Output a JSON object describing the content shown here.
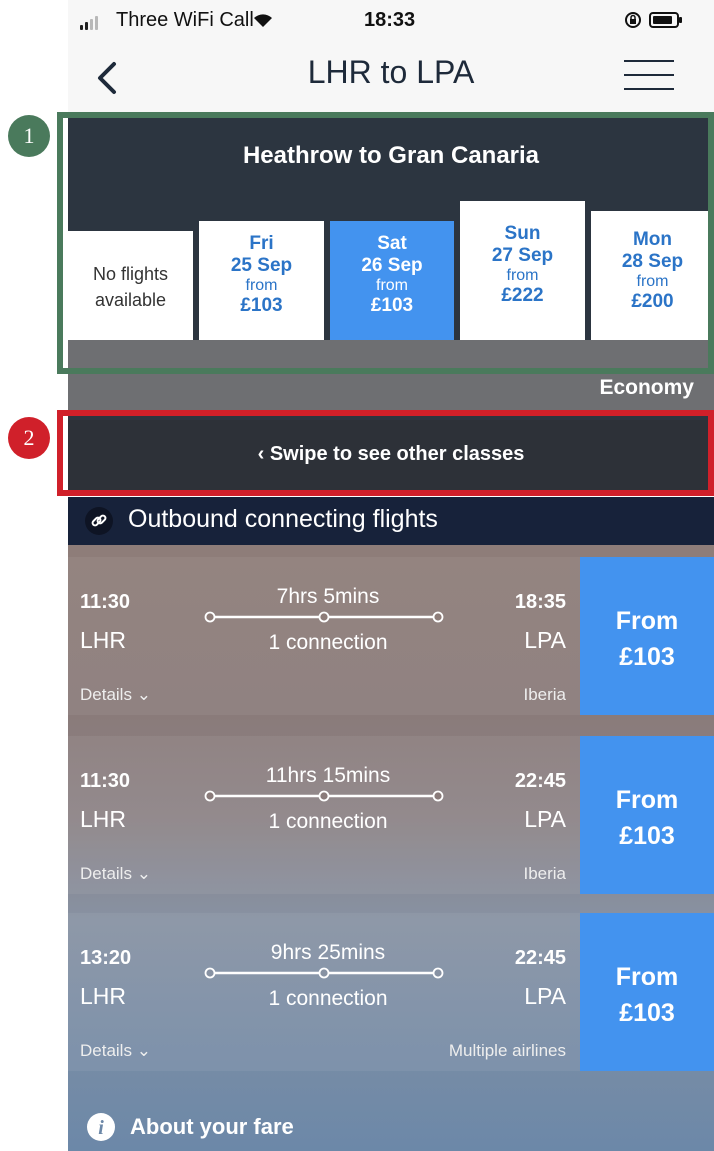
{
  "status_bar": {
    "carrier": "Three WiFi Call",
    "time": "18:33",
    "icons": [
      "signal-icon",
      "wifi-icon",
      "rotation-lock-icon",
      "battery-icon"
    ]
  },
  "nav": {
    "title": "LHR to LPA",
    "back_icon": "chevron-left-icon",
    "menu_icon": "hamburger-menu-icon"
  },
  "route_title": "Heathrow to Gran Canaria",
  "dates": [
    {
      "no_flights": "No flights available"
    },
    {
      "day": "Fri",
      "date": "25 Sep",
      "from": "from",
      "price": "£103",
      "selected": false
    },
    {
      "day": "Sat",
      "date": "26 Sep",
      "from": "from",
      "price": "£103",
      "selected": true
    },
    {
      "day": "Sun",
      "date": "27 Sep",
      "from": "from",
      "price": "£222",
      "selected": false
    },
    {
      "day": "Mon",
      "date": "28 Sep",
      "from": "from",
      "price": "£200",
      "selected": false
    }
  ],
  "cabin_class": "Economy",
  "swipe_hint": "‹ Swipe to see other classes",
  "section_title": "Outbound connecting flights",
  "flights": [
    {
      "dep_time": "11:30",
      "dep_code": "LHR",
      "duration": "7hrs 5mins",
      "connection": "1 connection",
      "arr_time": "18:35",
      "arr_code": "LPA",
      "details": "Details",
      "airline": "Iberia",
      "price_from": "From",
      "price": "£103"
    },
    {
      "dep_time": "11:30",
      "dep_code": "LHR",
      "duration": "11hrs 15mins",
      "connection": "1 connection",
      "arr_time": "22:45",
      "arr_code": "LPA",
      "details": "Details",
      "airline": "Iberia",
      "price_from": "From",
      "price": "£103"
    },
    {
      "dep_time": "13:20",
      "dep_code": "LHR",
      "duration": "9hrs 25mins",
      "connection": "1 connection",
      "arr_time": "22:45",
      "arr_code": "LPA",
      "details": "Details",
      "airline": "Multiple airlines",
      "price_from": "From",
      "price": "£103"
    }
  ],
  "about_fare": "About your fare",
  "annotations": [
    {
      "label": "1",
      "color": "#4a7a5c"
    },
    {
      "label": "2",
      "color": "#d0202a"
    }
  ],
  "colors": {
    "accent_blue": "#4393ef",
    "header_dark": "#2c3540",
    "section_navy": "#17223a"
  }
}
